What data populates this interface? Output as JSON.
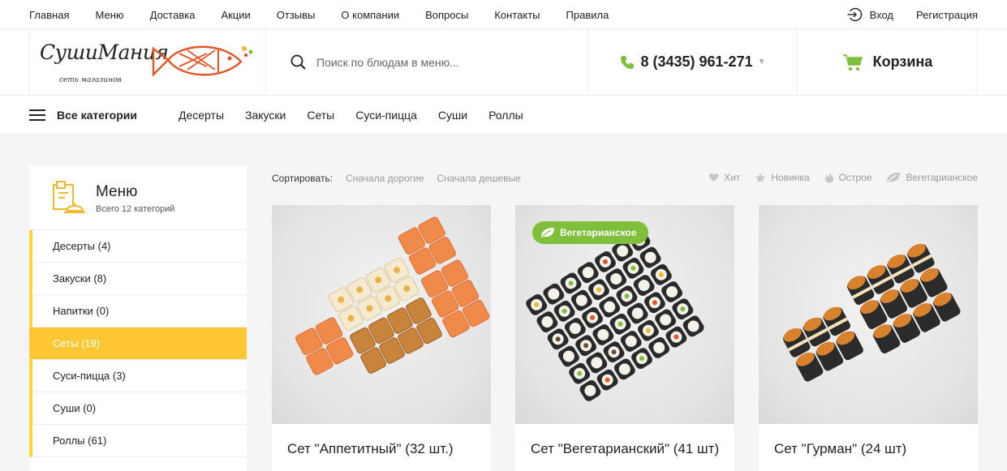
{
  "topnav": {
    "links": [
      "Главная",
      "Меню",
      "Доставка",
      "Акции",
      "Отзывы",
      "О компании",
      "Вопросы",
      "Контакты",
      "Правила"
    ],
    "login": "Вход",
    "register": "Регистрация"
  },
  "header": {
    "logo_text": "СушиМания",
    "logo_tagline": "сеть магазинов",
    "search_placeholder": "Поиск по блюдам в меню...",
    "phone": "8 (3435) 961-271",
    "cart": "Корзина",
    "colors": {
      "accent_green": "#7fbf3b",
      "logo_orange": "#e0582a"
    }
  },
  "categories_bar": {
    "all": "Все категории",
    "items": [
      "Десерты",
      "Закуски",
      "Сеты",
      "Суси-пицца",
      "Суши",
      "Роллы"
    ]
  },
  "sidebar": {
    "title": "Меню",
    "subtitle": "Всего 12 категорий",
    "items": [
      {
        "label": "Десерты (4)",
        "active": false
      },
      {
        "label": "Закуски (8)",
        "active": false
      },
      {
        "label": "Напитки (0)",
        "active": false
      },
      {
        "label": "Сеты (19)",
        "active": true
      },
      {
        "label": "Суси-пицца (3)",
        "active": false
      },
      {
        "label": "Суши (0)",
        "active": false
      },
      {
        "label": "Роллы (61)",
        "active": false
      }
    ],
    "colors": {
      "active_bg": "#fec733"
    }
  },
  "sort": {
    "label": "Сортировать:",
    "options": [
      "Сначала дорогие",
      "Сначала дешевые"
    ],
    "filters": [
      "Хит",
      "Новинка",
      "Острое",
      "Вегетарианское"
    ]
  },
  "products": [
    {
      "name": "Сет \"Аппетитный\" (32 шт.)",
      "badge": ""
    },
    {
      "name": "Сет \"Вегетарианский\" (41 шт)",
      "badge": "Вегетарианское"
    },
    {
      "name": "Сет \"Гурман\" (24 шт)",
      "badge": ""
    }
  ]
}
